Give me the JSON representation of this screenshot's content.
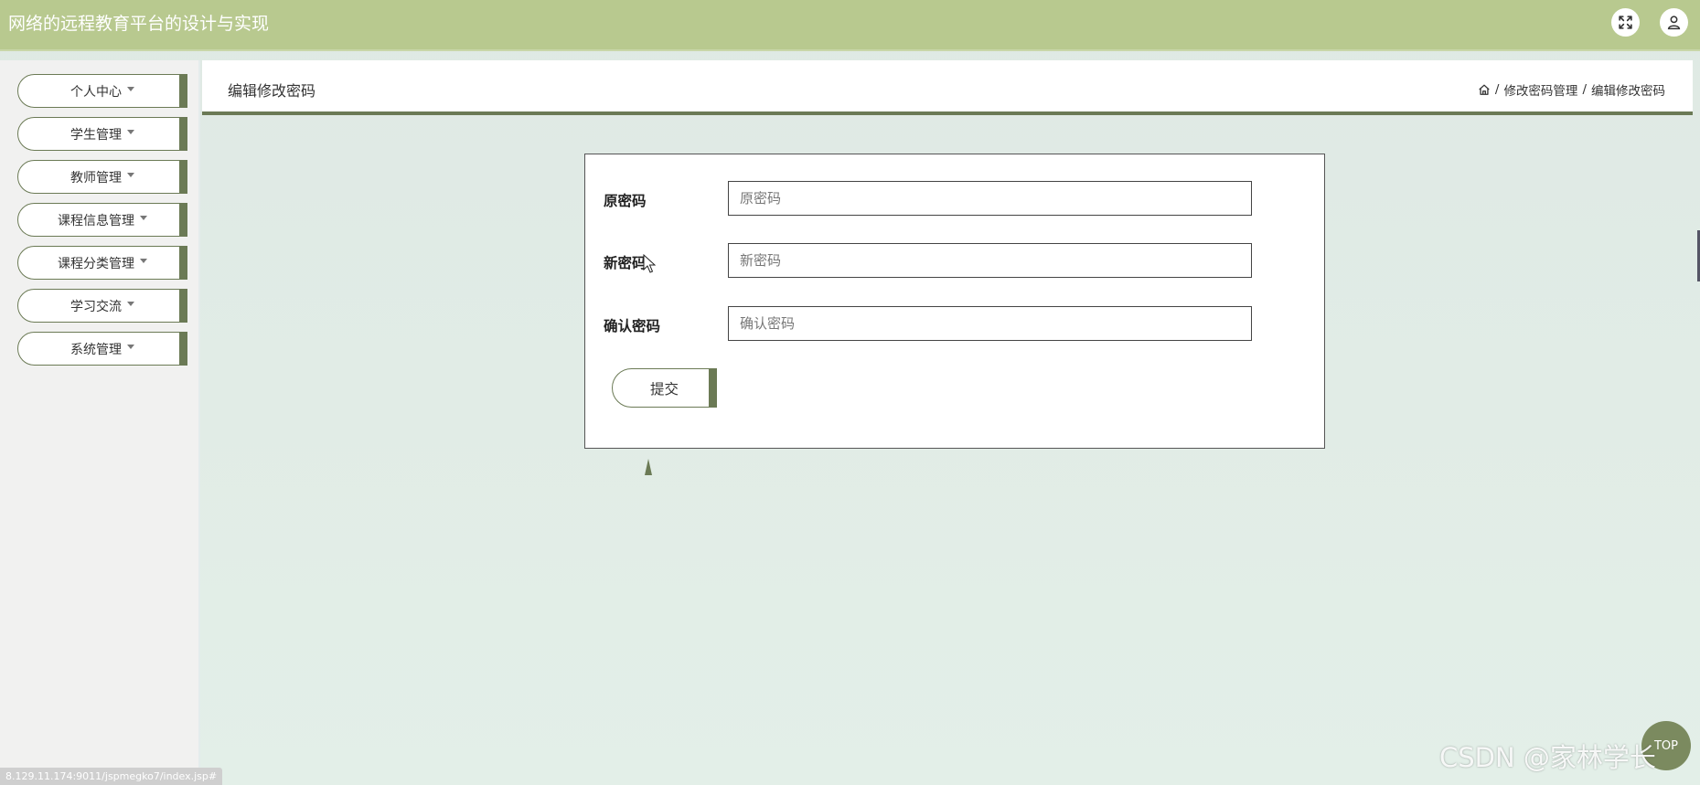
{
  "header": {
    "title": "网络的远程教育平台的设计与实现",
    "fullscreen_icon": "expand-icon",
    "user_icon": "user-icon"
  },
  "sidebar": {
    "items": [
      {
        "label": "个人中心"
      },
      {
        "label": "学生管理"
      },
      {
        "label": "教师管理"
      },
      {
        "label": "课程信息管理"
      },
      {
        "label": "课程分类管理"
      },
      {
        "label": "学习交流"
      },
      {
        "label": "系统管理"
      }
    ]
  },
  "page": {
    "title": "编辑修改密码",
    "breadcrumb": [
      "修改密码管理",
      "编辑修改密码"
    ],
    "breadcrumb_separator": "/"
  },
  "form": {
    "fields": [
      {
        "label": "原密码",
        "placeholder": "原密码"
      },
      {
        "label": "新密码",
        "placeholder": "新密码"
      },
      {
        "label": "确认密码",
        "placeholder": "确认密码"
      }
    ],
    "submit_label": "提交"
  },
  "status_bar": {
    "url": "8.129.11.174:9011/jspmegko7/index.jsp#"
  },
  "fab": {
    "label": "TOP"
  },
  "watermark": {
    "text": "CSDN @家林学长"
  },
  "colors": {
    "header_bg": "#b8c98f",
    "accent": "#6b7a55",
    "sidebar_bg": "#f1f1f0",
    "content_bg": "#dfe9e4"
  }
}
